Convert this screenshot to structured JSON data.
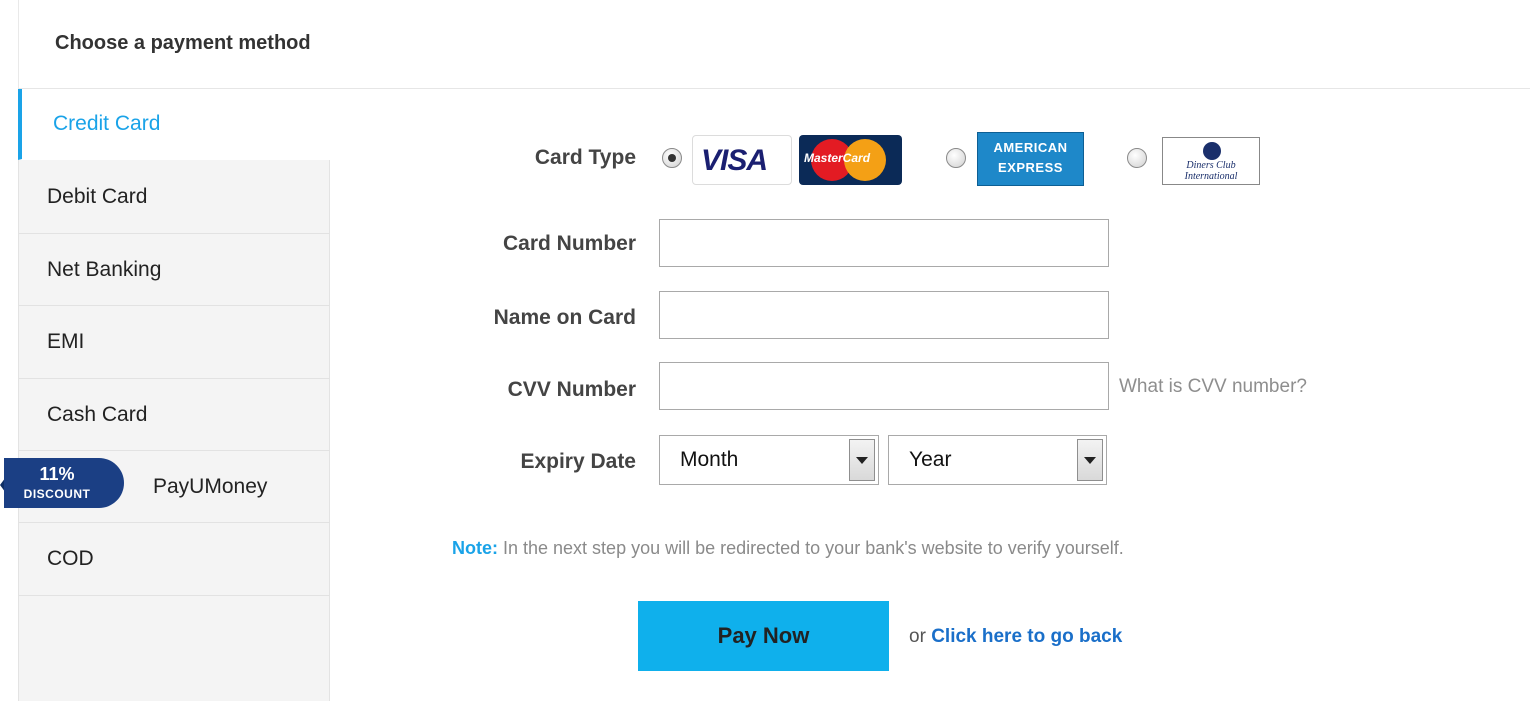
{
  "header": {
    "title": "Choose a payment method"
  },
  "sidebar": {
    "items": [
      {
        "label": "Credit Card"
      },
      {
        "label": "Debit Card"
      },
      {
        "label": "Net Banking"
      },
      {
        "label": "EMI"
      },
      {
        "label": "Cash Card"
      },
      {
        "label": "PayUMoney"
      },
      {
        "label": "COD"
      }
    ],
    "discount": {
      "percent": "11%",
      "word": "DISCOUNT"
    }
  },
  "form": {
    "card_type_label": "Card Type",
    "card_types": [
      {
        "logos": [
          "VISA",
          "MasterCard"
        ],
        "selected": true
      },
      {
        "logos": [
          "AMERICAN",
          "EXPRESS"
        ],
        "selected": false
      },
      {
        "logos": [
          "Diners Club",
          "International"
        ],
        "selected": false
      }
    ],
    "card_number_label": "Card Number",
    "card_number_value": "",
    "name_label": "Name on Card",
    "name_value": "",
    "cvv_label": "CVV Number",
    "cvv_value": "",
    "cvv_help": "What is CVV number?",
    "expiry_label": "Expiry Date",
    "month_value": "Month",
    "year_value": "Year",
    "note_prefix": "Note:",
    "note_text": " In the next step you will be redirected to your bank's website to verify yourself.",
    "pay_button": "Pay Now",
    "goback_prefix": "or ",
    "goback_link": "Click here to go back"
  },
  "colors": {
    "accent": "#1aa3e8",
    "pay_button": "#0fb0ec",
    "badge": "#1b3f84",
    "link": "#1a6fc9"
  }
}
